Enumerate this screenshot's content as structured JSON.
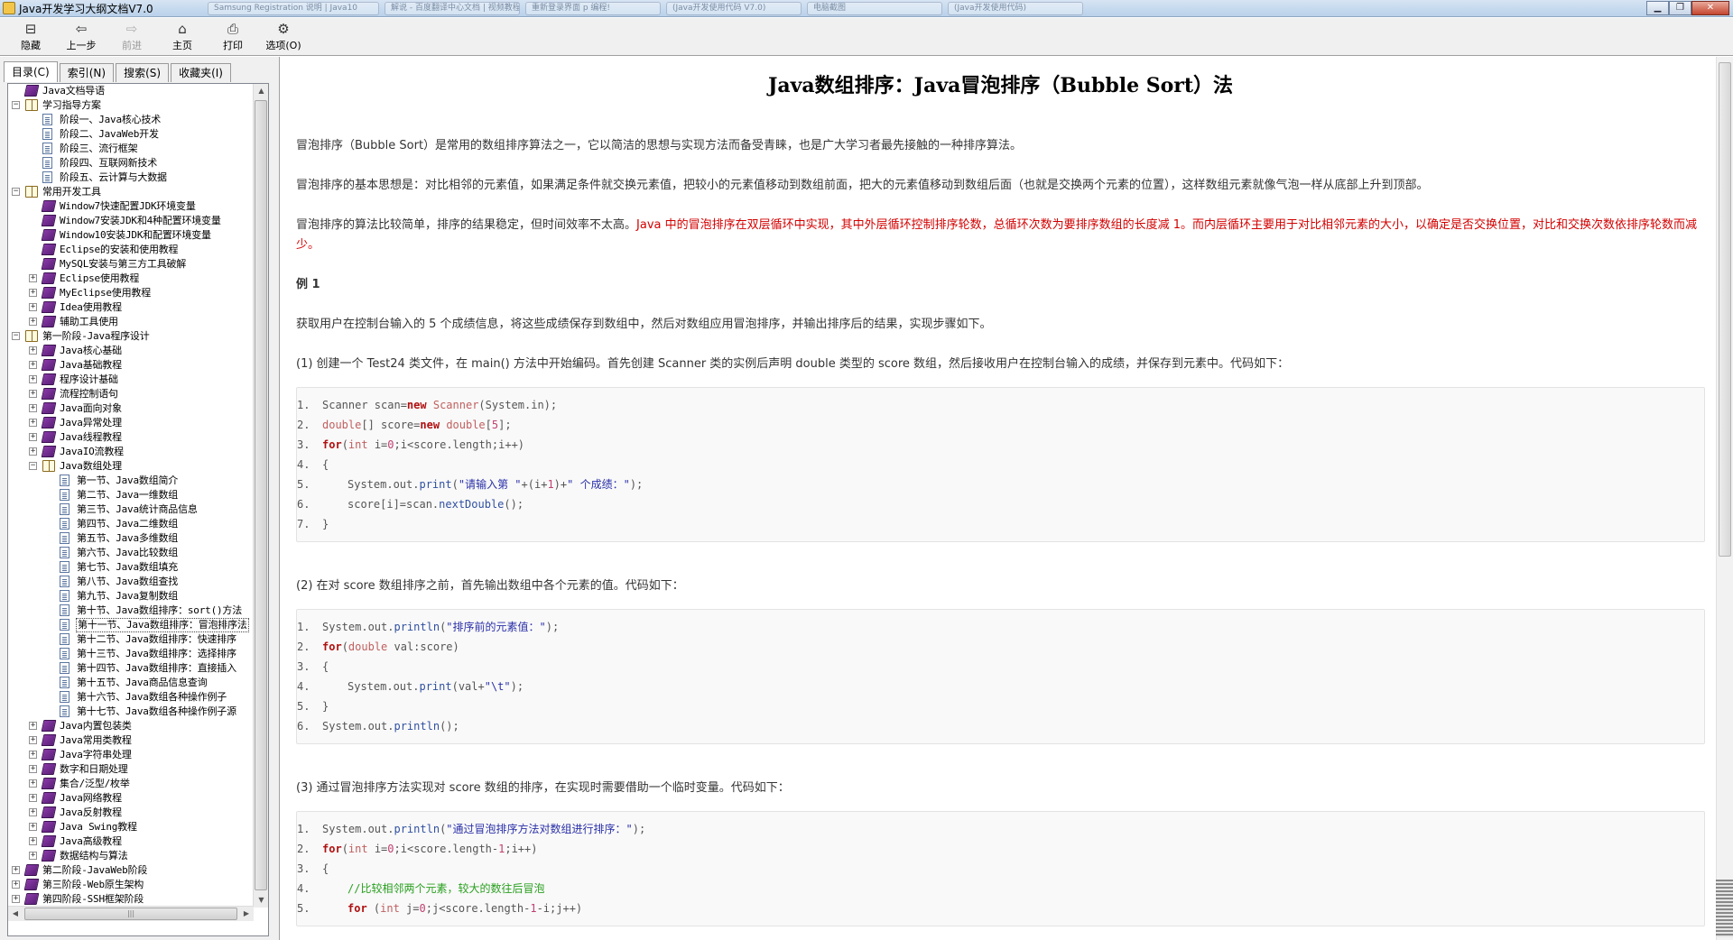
{
  "window": {
    "title": "Java开发学习大纲文档V7.0",
    "ghost_tabs": [
      "Samsung Registration 说明 | Java10",
      "解说 - 百度翻译中心文档 | 视频教程",
      "重新登录界面 p 编程!",
      "(Java开发使用代码 V7.0)",
      "电脑截图",
      "(Java开发使用代码)"
    ],
    "buttons": {
      "minimize": "▁",
      "maximize": "❐",
      "close": "✕"
    }
  },
  "toolbar": {
    "buttons": [
      {
        "label": "隐藏",
        "icon": "hide-icon",
        "glyph": "⊟",
        "enabled": true
      },
      {
        "label": "上一步",
        "icon": "back-arrow-icon",
        "glyph": "⇦",
        "enabled": true
      },
      {
        "label": "前进",
        "icon": "forward-arrow-icon",
        "glyph": "⇨",
        "enabled": false
      },
      {
        "label": "主页",
        "icon": "home-icon",
        "glyph": "⌂",
        "enabled": true
      },
      {
        "label": "打印",
        "icon": "print-icon",
        "glyph": "⎙",
        "enabled": true
      },
      {
        "label": "选项(O)",
        "icon": "options-icon",
        "glyph": "⚙",
        "enabled": true
      }
    ]
  },
  "nav": {
    "tabs": [
      {
        "label": "目录(C)",
        "active": true
      },
      {
        "label": "索引(N)",
        "active": false
      },
      {
        "label": "搜索(S)",
        "active": false
      },
      {
        "label": "收藏夹(I)",
        "active": false
      }
    ],
    "hscroll_grip": "|||",
    "tree": [
      {
        "label": "Java文档导语",
        "level": 0,
        "icon": "book",
        "expander": ""
      },
      {
        "label": "学习指导方案",
        "level": 0,
        "icon": "book-open",
        "expander": "−"
      },
      {
        "label": "阶段一、Java核心技术",
        "level": 1,
        "icon": "page",
        "expander": ""
      },
      {
        "label": "阶段二、JavaWeb开发",
        "level": 1,
        "icon": "page",
        "expander": ""
      },
      {
        "label": "阶段三、流行框架",
        "level": 1,
        "icon": "page",
        "expander": ""
      },
      {
        "label": "阶段四、互联网新技术",
        "level": 1,
        "icon": "page",
        "expander": ""
      },
      {
        "label": "阶段五、云计算与大数据",
        "level": 1,
        "icon": "page",
        "expander": ""
      },
      {
        "label": "常用开发工具",
        "level": 0,
        "icon": "book-open",
        "expander": "−"
      },
      {
        "label": "Window7快速配置JDK环境变量",
        "level": 1,
        "icon": "book",
        "expander": ""
      },
      {
        "label": "Window7安装JDK和4种配置环境变量",
        "level": 1,
        "icon": "book",
        "expander": ""
      },
      {
        "label": "Window10安装JDK和配置环境变量",
        "level": 1,
        "icon": "book",
        "expander": ""
      },
      {
        "label": "Eclipse的安装和使用教程",
        "level": 1,
        "icon": "book",
        "expander": ""
      },
      {
        "label": "MySQL安装与第三方工具破解",
        "level": 1,
        "icon": "book",
        "expander": ""
      },
      {
        "label": "Eclipse使用教程",
        "level": 1,
        "icon": "book",
        "expander": "+"
      },
      {
        "label": "MyEclipse使用教程",
        "level": 1,
        "icon": "book",
        "expander": "+"
      },
      {
        "label": "Idea使用教程",
        "level": 1,
        "icon": "book",
        "expander": "+"
      },
      {
        "label": "辅助工具使用",
        "level": 1,
        "icon": "book",
        "expander": "+"
      },
      {
        "label": "第一阶段-Java程序设计",
        "level": 0,
        "icon": "book-open",
        "expander": "−"
      },
      {
        "label": "Java核心基础",
        "level": 1,
        "icon": "book",
        "expander": "+"
      },
      {
        "label": "Java基础教程",
        "level": 1,
        "icon": "book",
        "expander": "+"
      },
      {
        "label": "程序设计基础",
        "level": 1,
        "icon": "book",
        "expander": "+"
      },
      {
        "label": "流程控制语句",
        "level": 1,
        "icon": "book",
        "expander": "+"
      },
      {
        "label": "Java面向对象",
        "level": 1,
        "icon": "book",
        "expander": "+"
      },
      {
        "label": "Java异常处理",
        "level": 1,
        "icon": "book",
        "expander": "+"
      },
      {
        "label": "Java线程教程",
        "level": 1,
        "icon": "book",
        "expander": "+"
      },
      {
        "label": "JavaIO流教程",
        "level": 1,
        "icon": "book",
        "expander": "+"
      },
      {
        "label": "Java数组处理",
        "level": 1,
        "icon": "book-open",
        "expander": "−"
      },
      {
        "label": "第一节、Java数组简介",
        "level": 2,
        "icon": "page",
        "expander": ""
      },
      {
        "label": "第二节、Java一维数组",
        "level": 2,
        "icon": "page",
        "expander": ""
      },
      {
        "label": "第三节、Java统计商品信息",
        "level": 2,
        "icon": "page",
        "expander": ""
      },
      {
        "label": "第四节、Java二维数组",
        "level": 2,
        "icon": "page",
        "expander": ""
      },
      {
        "label": "第五节、Java多维数组",
        "level": 2,
        "icon": "page",
        "expander": ""
      },
      {
        "label": "第六节、Java比较数组",
        "level": 2,
        "icon": "page",
        "expander": ""
      },
      {
        "label": "第七节、Java数组填充",
        "level": 2,
        "icon": "page",
        "expander": ""
      },
      {
        "label": "第八节、Java数组查找",
        "level": 2,
        "icon": "page",
        "expander": ""
      },
      {
        "label": "第九节、Java复制数组",
        "level": 2,
        "icon": "page",
        "expander": ""
      },
      {
        "label": "第十节、Java数组排序：sort()方法",
        "level": 2,
        "icon": "page",
        "expander": ""
      },
      {
        "label": "第十一节、Java数组排序：冒泡排序法",
        "level": 2,
        "icon": "page",
        "expander": "",
        "selected": true
      },
      {
        "label": "第十二节、Java数组排序：快速排序",
        "level": 2,
        "icon": "page",
        "expander": ""
      },
      {
        "label": "第十三节、Java数组排序：选择排序",
        "level": 2,
        "icon": "page",
        "expander": ""
      },
      {
        "label": "第十四节、Java数组排序：直接插入",
        "level": 2,
        "icon": "page",
        "expander": ""
      },
      {
        "label": "第十五节、Java商品信息查询",
        "level": 2,
        "icon": "page",
        "expander": ""
      },
      {
        "label": "第十六节、Java数组各种操作例子",
        "level": 2,
        "icon": "page",
        "expander": ""
      },
      {
        "label": "第十七节、Java数组各种操作例子源",
        "level": 2,
        "icon": "page",
        "expander": ""
      },
      {
        "label": "Java内置包装类",
        "level": 1,
        "icon": "book",
        "expander": "+"
      },
      {
        "label": "Java常用类教程",
        "level": 1,
        "icon": "book",
        "expander": "+"
      },
      {
        "label": "Java字符串处理",
        "level": 1,
        "icon": "book",
        "expander": "+"
      },
      {
        "label": "数字和日期处理",
        "level": 1,
        "icon": "book",
        "expander": "+"
      },
      {
        "label": "集合/泛型/枚举",
        "level": 1,
        "icon": "book",
        "expander": "+"
      },
      {
        "label": "Java网络教程",
        "level": 1,
        "icon": "book",
        "expander": "+"
      },
      {
        "label": "Java反射教程",
        "level": 1,
        "icon": "book",
        "expander": "+"
      },
      {
        "label": "Java Swing教程",
        "level": 1,
        "icon": "book",
        "expander": "+"
      },
      {
        "label": "Java高级教程",
        "level": 1,
        "icon": "book",
        "expander": "+"
      },
      {
        "label": "数据结构与算法",
        "level": 1,
        "icon": "book",
        "expander": "+"
      },
      {
        "label": "第二阶段-JavaWeb阶段",
        "level": 0,
        "icon": "book",
        "expander": "+"
      },
      {
        "label": "第三阶段-Web原生架构",
        "level": 0,
        "icon": "book",
        "expander": "+"
      },
      {
        "label": "第四阶段-SSH框架阶段",
        "level": 0,
        "icon": "book",
        "expander": "+"
      }
    ]
  },
  "article": {
    "title": "Java数组排序：Java冒泡排序（Bubble Sort）法",
    "intro1": "冒泡排序（Bubble Sort）是常用的数组排序算法之一，它以简洁的思想与实现方法而备受青睐，也是广大学习者最先接触的一种排序算法。",
    "intro2": "冒泡排序的基本思想是：对比相邻的元素值，如果满足条件就交换元素值，把较小的元素值移动到数组前面，把大的元素值移动到数组后面（也就是交换两个元素的位置），这样数组元素就像气泡一样从底部上升到顶部。",
    "intro3_plain": "冒泡排序的算法比较简单，排序的结果稳定，但时间效率不太高。",
    "intro3_red": "Java 中的冒泡排序在双层循环中实现，其中外层循环控制排序轮数，总循环次数为要排序数组的长度减 1。而内层循环主要用于对比相邻元素的大小，以确定是否交换位置，对比和交换次数依排序轮数而减少。",
    "example_heading": "例 1",
    "example_desc": "获取用户在控制台输入的 5 个成绩信息，将这些成绩保存到数组中，然后对数组应用冒泡排序，并输出排序后的结果，实现步骤如下。",
    "step1": "(1) 创建一个 Test24 类文件，在 main() 方法中开始编码。首先创建 Scanner 类的实例后声明 double 类型的 score 数组，然后接收用户在控制台输入的成绩，并保存到元素中。代码如下：",
    "step2": "(2) 在对 score 数组排序之前，首先输出数组中各个元素的值。代码如下：",
    "step3": "(3) 通过冒泡排序方法实现对 score 数组的排序，在实现时需要借助一个临时变量。代码如下：",
    "code1": [
      {
        "n": "1.",
        "indent": 0,
        "tokens": [
          [
            "",
            "Scanner scan="
          ],
          [
            "kw",
            "new"
          ],
          [
            "",
            " "
          ],
          [
            "tp",
            "Scanner"
          ],
          [
            "",
            "(System.in);"
          ]
        ]
      },
      {
        "n": "2.",
        "indent": 0,
        "tokens": [
          [
            "tp",
            "double"
          ],
          [
            "",
            "[] score="
          ],
          [
            "kw",
            "new"
          ],
          [
            "",
            " "
          ],
          [
            "tp",
            "double"
          ],
          [
            "",
            "["
          ],
          [
            "num",
            "5"
          ],
          [
            "",
            "];"
          ]
        ]
      },
      {
        "n": "3.",
        "indent": 0,
        "tokens": [
          [
            "kw",
            "for"
          ],
          [
            "",
            "("
          ],
          [
            "tp",
            "int"
          ],
          [
            "",
            " i="
          ],
          [
            "num",
            "0"
          ],
          [
            "",
            ";i<score.length;i++)"
          ]
        ]
      },
      {
        "n": "4.",
        "indent": 0,
        "tokens": [
          [
            "",
            "{"
          ]
        ]
      },
      {
        "n": "5.",
        "indent": 1,
        "tokens": [
          [
            "",
            "System.out."
          ],
          [
            "fn",
            "print"
          ],
          [
            "",
            "("
          ],
          [
            "str",
            "\"请输入第 \""
          ],
          [
            "",
            "+(i+"
          ],
          [
            "num",
            "1"
          ],
          [
            "",
            ")+"
          ],
          [
            "str",
            "\" 个成绩：\""
          ],
          [
            "",
            ");"
          ]
        ]
      },
      {
        "n": "6.",
        "indent": 1,
        "tokens": [
          [
            "",
            "score[i]=scan."
          ],
          [
            "fn",
            "nextDouble"
          ],
          [
            "",
            "();"
          ]
        ]
      },
      {
        "n": "7.",
        "indent": 0,
        "tokens": [
          [
            "",
            "}"
          ]
        ]
      }
    ],
    "code2": [
      {
        "n": "1.",
        "indent": 0,
        "tokens": [
          [
            "",
            "System.out."
          ],
          [
            "fn",
            "println"
          ],
          [
            "",
            "("
          ],
          [
            "str",
            "\"排序前的元素值：\""
          ],
          [
            "",
            ");"
          ]
        ]
      },
      {
        "n": "2.",
        "indent": 0,
        "tokens": [
          [
            "kw",
            "for"
          ],
          [
            "",
            "("
          ],
          [
            "tp",
            "double"
          ],
          [
            "",
            " val:score)"
          ]
        ]
      },
      {
        "n": "3.",
        "indent": 0,
        "tokens": [
          [
            "",
            "{"
          ]
        ]
      },
      {
        "n": "4.",
        "indent": 1,
        "tokens": [
          [
            "",
            "System.out."
          ],
          [
            "fn",
            "print"
          ],
          [
            "",
            "(val+"
          ],
          [
            "str",
            "\"\\t\""
          ],
          [
            "",
            ");"
          ]
        ]
      },
      {
        "n": "5.",
        "indent": 0,
        "tokens": [
          [
            "",
            "}"
          ]
        ]
      },
      {
        "n": "6.",
        "indent": 0,
        "tokens": [
          [
            "",
            "System.out."
          ],
          [
            "fn",
            "println"
          ],
          [
            "",
            "();"
          ]
        ]
      }
    ],
    "code3": [
      {
        "n": "1.",
        "indent": 0,
        "tokens": [
          [
            "",
            "System.out."
          ],
          [
            "fn",
            "println"
          ],
          [
            "",
            "("
          ],
          [
            "str",
            "\"通过冒泡排序方法对数组进行排序：\""
          ],
          [
            "",
            ");"
          ]
        ]
      },
      {
        "n": "2.",
        "indent": 0,
        "tokens": [
          [
            "kw",
            "for"
          ],
          [
            "",
            "("
          ],
          [
            "tp",
            "int"
          ],
          [
            "",
            " i="
          ],
          [
            "num",
            "0"
          ],
          [
            "",
            ";i<score.length-"
          ],
          [
            "num",
            "1"
          ],
          [
            "",
            ";i++)"
          ]
        ]
      },
      {
        "n": "3.",
        "indent": 0,
        "tokens": [
          [
            "",
            "{"
          ]
        ]
      },
      {
        "n": "4.",
        "indent": 1,
        "tokens": [
          [
            "cm",
            "//比较相邻两个元素，较大的数往后冒泡"
          ]
        ]
      },
      {
        "n": "5.",
        "indent": 1,
        "tokens": [
          [
            "kw",
            "for"
          ],
          [
            "",
            " ("
          ],
          [
            "tp",
            "int"
          ],
          [
            "",
            " j="
          ],
          [
            "num",
            "0"
          ],
          [
            "",
            ";j<score.length-"
          ],
          [
            "num",
            "1"
          ],
          [
            "",
            "-i;j++)"
          ]
        ]
      }
    ]
  },
  "colors": {
    "accent_red": "#d20000",
    "tree_book": "#6a2a8a",
    "code_bg": "#f9f9f9"
  }
}
